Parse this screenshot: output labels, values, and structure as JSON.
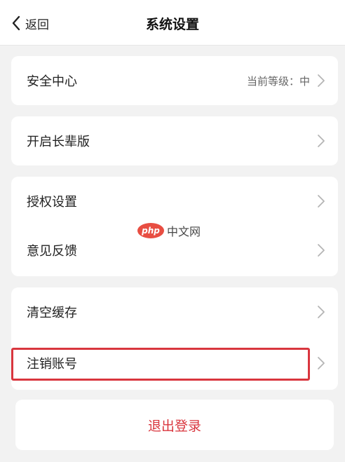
{
  "header": {
    "back_label": "返回",
    "title": "系统设置"
  },
  "groups": [
    {
      "items": [
        {
          "label": "安全中心",
          "value": "当前等级：中"
        }
      ]
    },
    {
      "items": [
        {
          "label": "开启长辈版"
        }
      ]
    },
    {
      "items": [
        {
          "label": "授权设置"
        },
        {
          "label": "意见反馈"
        }
      ]
    },
    {
      "items": [
        {
          "label": "清空缓存"
        },
        {
          "label": "注销账号"
        }
      ]
    }
  ],
  "logout": {
    "label": "退出登录"
  },
  "watermark": {
    "logo": "php",
    "text": "中文网"
  },
  "colors": {
    "accent_red": "#d9363e",
    "background": "#f2f2f2",
    "card": "#ffffff"
  },
  "icons": {
    "back": "chevron-left-icon",
    "row_arrow": "chevron-right-icon"
  }
}
